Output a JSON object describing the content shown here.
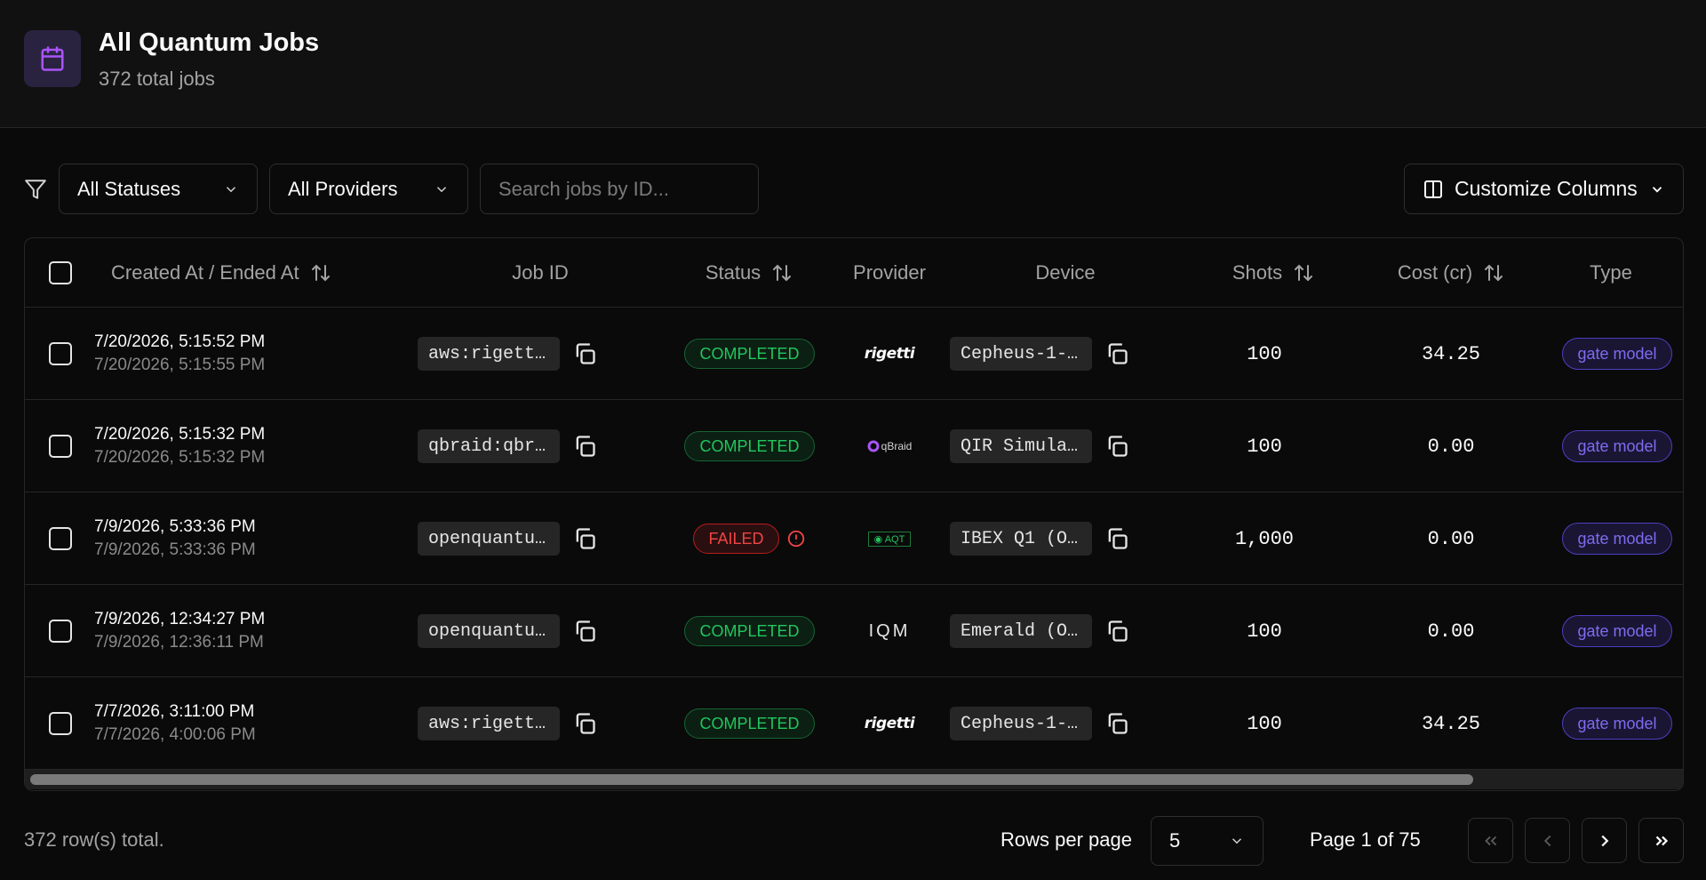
{
  "header": {
    "title": "All Quantum Jobs",
    "subtitle": "372 total jobs",
    "icon": "calendar-icon",
    "accent_color": "#a855f7"
  },
  "filters": {
    "status_select": "All Statuses",
    "provider_select": "All Providers",
    "search_placeholder": "Search jobs by ID...",
    "customize_label": "Customize Columns"
  },
  "table": {
    "columns": {
      "created": "Created At / Ended At",
      "job_id": "Job ID",
      "status": "Status",
      "provider": "Provider",
      "device": "Device",
      "shots": "Shots",
      "cost": "Cost (cr)",
      "type": "Type"
    },
    "rows": [
      {
        "created": "7/20/2026, 5:15:52 PM",
        "ended": "7/20/2026, 5:15:55 PM",
        "job_id": "aws:rigetti...",
        "status": "COMPLETED",
        "provider": "rigetti",
        "device": "Cepheus-1-...",
        "shots": "100",
        "cost": "34.25",
        "type": "gate model"
      },
      {
        "created": "7/20/2026, 5:15:32 PM",
        "ended": "7/20/2026, 5:15:32 PM",
        "job_id": "qbraid:qbr...",
        "status": "COMPLETED",
        "provider": "qBraid",
        "device": "QIR Simula...",
        "shots": "100",
        "cost": "0.00",
        "type": "gate model"
      },
      {
        "created": "7/9/2026, 5:33:36 PM",
        "ended": "7/9/2026, 5:33:36 PM",
        "job_id": "openquantu...",
        "status": "FAILED",
        "provider": "AQT",
        "device": "IBEX Q1 (O...",
        "shots": "1,000",
        "cost": "0.00",
        "type": "gate model"
      },
      {
        "created": "7/9/2026, 12:34:27 PM",
        "ended": "7/9/2026, 12:36:11 PM",
        "job_id": "openquantu...",
        "status": "COMPLETED",
        "provider": "IQM",
        "device": "Emerald (O...",
        "shots": "100",
        "cost": "0.00",
        "type": "gate model"
      },
      {
        "created": "7/7/2026, 3:11:00 PM",
        "ended": "7/7/2026, 4:00:06 PM",
        "job_id": "aws:rigetti...",
        "status": "COMPLETED",
        "provider": "rigetti",
        "device": "Cepheus-1-...",
        "shots": "100",
        "cost": "34.25",
        "type": "gate model"
      }
    ]
  },
  "footer": {
    "total": "372 row(s) total.",
    "rows_per_page_label": "Rows per page",
    "rows_per_page_value": "5",
    "page_info": "Page 1 of 75"
  },
  "colors": {
    "completed": "#22c55e",
    "failed": "#ef4444",
    "type_badge": "#7c6cf0"
  }
}
